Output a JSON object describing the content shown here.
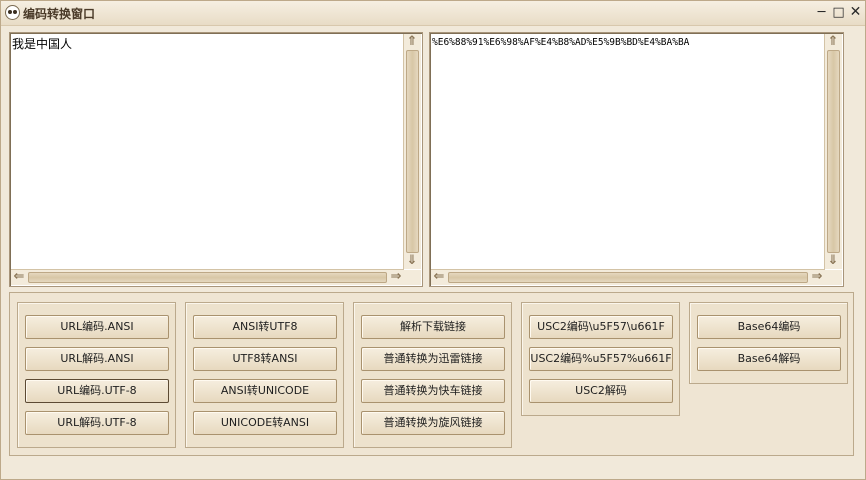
{
  "window": {
    "title": "编码转换窗口",
    "controls": {
      "minimize": "─",
      "maximize": "□",
      "close": "✕"
    }
  },
  "input_box": {
    "value": "我是中国人"
  },
  "output_box": {
    "value": "%E6%88%91%E6%98%AF%E4%B8%AD%E5%9B%BD%E4%BA%BA"
  },
  "groups": {
    "url": {
      "buttons": [
        "URL编码.ANSI",
        "URL解码.ANSI",
        "URL编码.UTF-8",
        "URL解码.UTF-8"
      ]
    },
    "charset": {
      "buttons": [
        "ANSI转UTF8",
        "UTF8转ANSI",
        "ANSI转UNICODE",
        "UNICODE转ANSI"
      ]
    },
    "links": {
      "buttons": [
        "解析下载链接",
        "普通转换为迅雷链接",
        "普通转换为快车链接",
        "普通转换为旋风链接"
      ]
    },
    "usc2": {
      "buttons": [
        "USC2编码\\u5F57\\u661F",
        "USC2编码%u5F57%u661F",
        "USC2解码"
      ]
    },
    "base64": {
      "buttons": [
        "Base64编码",
        "Base64解码"
      ]
    }
  },
  "icons": {
    "scroll_up": "⇑",
    "scroll_down": "⇓",
    "scroll_left": "⇐",
    "scroll_right": "⇒"
  },
  "colors": {
    "background": "#efe6d6",
    "border": "#bba98c",
    "button": "#eee3cc"
  }
}
